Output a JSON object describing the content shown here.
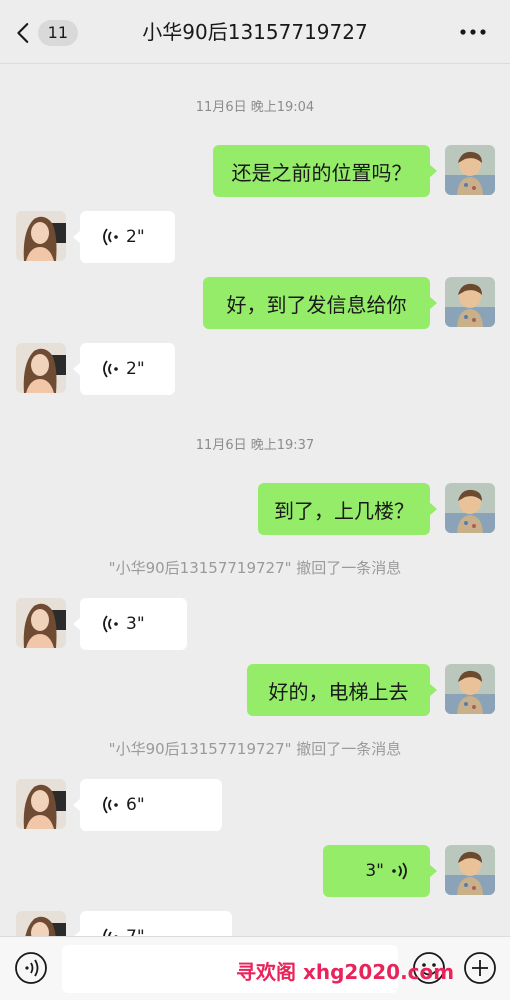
{
  "header": {
    "back_badge": "11",
    "title": "小华90后13157719727"
  },
  "timestamps": [
    "11月6日 晚上19:04",
    "11月6日 晚上19:37"
  ],
  "system_notices": [
    "\"小华90后13157719727\" 撤回了一条消息",
    "\"小华90后13157719727\" 撤回了一条消息"
  ],
  "messages": {
    "m1": "还是之前的位置吗？",
    "m2": "2\"",
    "m3": "好，到了发信息给你",
    "m4": "2\"",
    "m5": "到了，上几楼？",
    "m6": "3\"",
    "m7": "好的，电梯上去",
    "m8": "6\"",
    "m9": "3\"",
    "m10": "7\""
  },
  "watermark": "寻欢阁 xhg2020.com",
  "colors": {
    "background": "#ededed",
    "outgoing_bubble": "#95ec69",
    "incoming_bubble": "#ffffff",
    "watermark": "#e8245b"
  },
  "icons": [
    "back-chevron-icon",
    "more-dots-icon",
    "voice-wave-icon",
    "voice-input-icon",
    "emoji-icon",
    "plus-icon"
  ]
}
